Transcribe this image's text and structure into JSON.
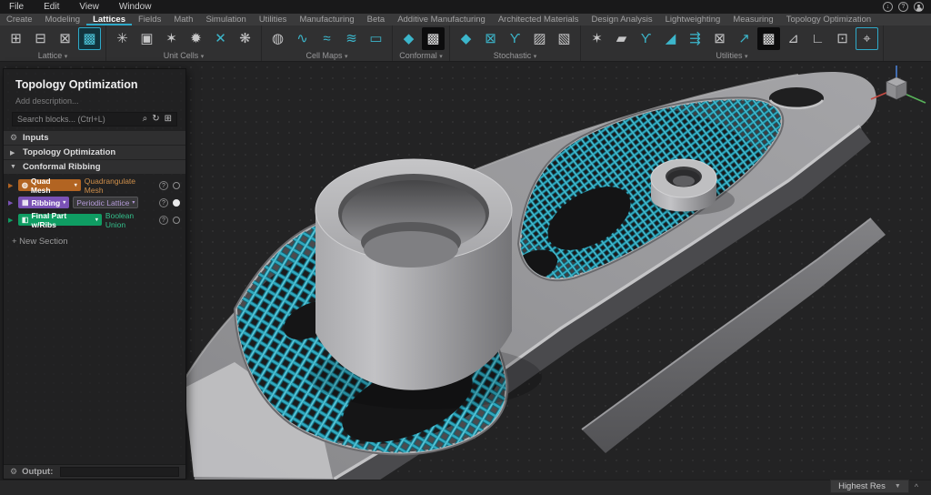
{
  "ui": {
    "caret_down": "▾",
    "collapsed_arrow": "▶",
    "expanded_arrow": "▼",
    "gear": "⚙",
    "question": "?",
    "plus": "+",
    "chevron_up": "^",
    "down_arrow": "↓",
    "search_refresh": "↻",
    "search_add": "⊞",
    "search_glass": "⌕"
  },
  "menu_bar": {
    "items": [
      {
        "label": "File"
      },
      {
        "label": "Edit"
      },
      {
        "label": "View"
      },
      {
        "label": "Window"
      }
    ]
  },
  "window_buttons": {
    "download": "↓",
    "help": "?"
  },
  "tab_bar": {
    "tabs": [
      {
        "label": "Create",
        "active": false
      },
      {
        "label": "Modeling",
        "active": false
      },
      {
        "label": "Lattices",
        "active": true
      },
      {
        "label": "Fields",
        "active": false
      },
      {
        "label": "Math",
        "active": false
      },
      {
        "label": "Simulation",
        "active": false
      },
      {
        "label": "Utilities",
        "active": false
      },
      {
        "label": "Manufacturing",
        "active": false
      },
      {
        "label": "Beta",
        "active": false
      },
      {
        "label": "Additive Manufacturing",
        "active": false
      },
      {
        "label": "Architected Materials",
        "active": false
      },
      {
        "label": "Design Analysis",
        "active": false
      },
      {
        "label": "Lightweighting",
        "active": false
      },
      {
        "label": "Measuring",
        "active": false
      },
      {
        "label": "Topology Optimization",
        "active": false
      }
    ],
    "active_underline_color": "#2fa9c8"
  },
  "ribbon": {
    "groups": [
      {
        "label": "Lattice",
        "icons": [
          {
            "name": "beam-lattice-sphere-icon",
            "glyph": "⊞",
            "state": "normal"
          },
          {
            "name": "beam-lattice-cylinder-icon",
            "glyph": "⊟",
            "state": "normal"
          },
          {
            "name": "beam-lattice-round-icon",
            "glyph": "⊠",
            "state": "normal"
          },
          {
            "name": "volume-lattice-icon",
            "glyph": "▩",
            "state": "active"
          }
        ]
      },
      {
        "label": "Unit Cells",
        "icons": [
          {
            "name": "unit-cell-star-icon",
            "glyph": "✳",
            "state": "normal"
          },
          {
            "name": "unit-cell-box-icon",
            "glyph": "▣",
            "state": "normal"
          },
          {
            "name": "unit-cell-graph-1-icon",
            "glyph": "✶",
            "state": "normal"
          },
          {
            "name": "unit-cell-graph-2-icon",
            "glyph": "✹",
            "state": "normal"
          },
          {
            "name": "custom-unit-cell-icon",
            "glyph": "✕",
            "state": "teal"
          },
          {
            "name": "unit-cell-swirl-icon",
            "glyph": "❋",
            "state": "normal"
          }
        ]
      },
      {
        "label": "Cell Maps",
        "icons": [
          {
            "name": "cell-map-sphere-icon",
            "glyph": "◍",
            "state": "normal"
          },
          {
            "name": "surface-cell-map-icon",
            "glyph": "∿",
            "state": "teal"
          },
          {
            "name": "swept-cell-map-icon",
            "glyph": "≈",
            "state": "teal"
          },
          {
            "name": "volume-cell-map-icon",
            "glyph": "≋",
            "state": "teal"
          },
          {
            "name": "planar-cell-map-icon",
            "glyph": "▭",
            "state": "teal"
          }
        ]
      },
      {
        "label": "Conformal",
        "icons": [
          {
            "name": "conformal-lattice-icon",
            "glyph": "◆",
            "state": "teal"
          },
          {
            "name": "voxel-lattice-icon",
            "glyph": "▩",
            "state": "sel"
          }
        ]
      },
      {
        "label": "Stochastic",
        "icons": [
          {
            "name": "voronoi-lattice-icon",
            "glyph": "◆",
            "state": "teal"
          },
          {
            "name": "voronoi-volume-icon",
            "glyph": "⊠",
            "state": "teal"
          },
          {
            "name": "strut-graph-icon",
            "glyph": "ϒ",
            "state": "teal"
          },
          {
            "name": "random-seed-box-icon",
            "glyph": "▨",
            "state": "normal"
          },
          {
            "name": "stochastic-volume-icon",
            "glyph": "▧",
            "state": "normal"
          }
        ]
      },
      {
        "label": "Utilities",
        "icons": [
          {
            "name": "lattice-from-graph-icon",
            "glyph": "✶",
            "state": "normal"
          },
          {
            "name": "thicken-strut-icon",
            "glyph": "▰",
            "state": "normal"
          },
          {
            "name": "split-graph-icon",
            "glyph": "ϒ",
            "state": "teal"
          },
          {
            "name": "ramp-thickness-icon",
            "glyph": "◢",
            "state": "teal"
          },
          {
            "name": "array-graph-icon",
            "glyph": "⇶",
            "state": "teal"
          },
          {
            "name": "warp-graph-icon",
            "glyph": "⊠",
            "state": "normal"
          },
          {
            "name": "move-graph-icon",
            "glyph": "↗",
            "state": "teal"
          },
          {
            "name": "frame-box-icon",
            "glyph": "▩",
            "state": "sel"
          },
          {
            "name": "measure-beam-icon",
            "glyph": "⊿",
            "state": "normal"
          },
          {
            "name": "axes-icon",
            "glyph": "∟",
            "state": "normal"
          },
          {
            "name": "pin-cube-icon",
            "glyph": "⊡",
            "state": "normal"
          },
          {
            "name": "render-view-icon",
            "glyph": "⌖",
            "state": "teal-box"
          }
        ]
      }
    ]
  },
  "sidebar": {
    "title": "Topology Optimization",
    "description_placeholder": "Add description...",
    "search_placeholder": "Search blocks... (Ctrl+L)",
    "sections": [
      {
        "label": "Inputs"
      },
      {
        "label": "Topology Optimization"
      },
      {
        "label": "Conformal Ribbing"
      }
    ],
    "blocks": [
      {
        "name": "Quad Mesh",
        "type": "Quadrangulate Mesh",
        "color": "#b26422",
        "type_color": "#cf8f4a",
        "badge_glyph": "◍",
        "dropdown": false,
        "filled": false
      },
      {
        "name": "Ribbing",
        "type": "Periodic Lattice",
        "color": "#7a52b5",
        "type_color": "#b49bd9",
        "badge_glyph": "▦",
        "dropdown": true,
        "filled": true
      },
      {
        "name": "Final Part w/Ribs",
        "type": "Boolean Union",
        "color": "#0f9d63",
        "type_color": "#34c08c",
        "badge_glyph": "◧",
        "dropdown": false,
        "filled": false
      }
    ],
    "new_section_label": "+ New Section",
    "output_label": "Output:"
  },
  "viewport": {
    "resolution_selector": "Highest Res",
    "colors": {
      "lattice_teal": "#2fa9bf",
      "lattice_shadow": "#0f5f6e",
      "part_gray": "#95959",
      "background": "#232324",
      "axis_x": "#c64a42",
      "axis_y": "#58b35a",
      "axis_z": "#4a7fd4"
    }
  }
}
